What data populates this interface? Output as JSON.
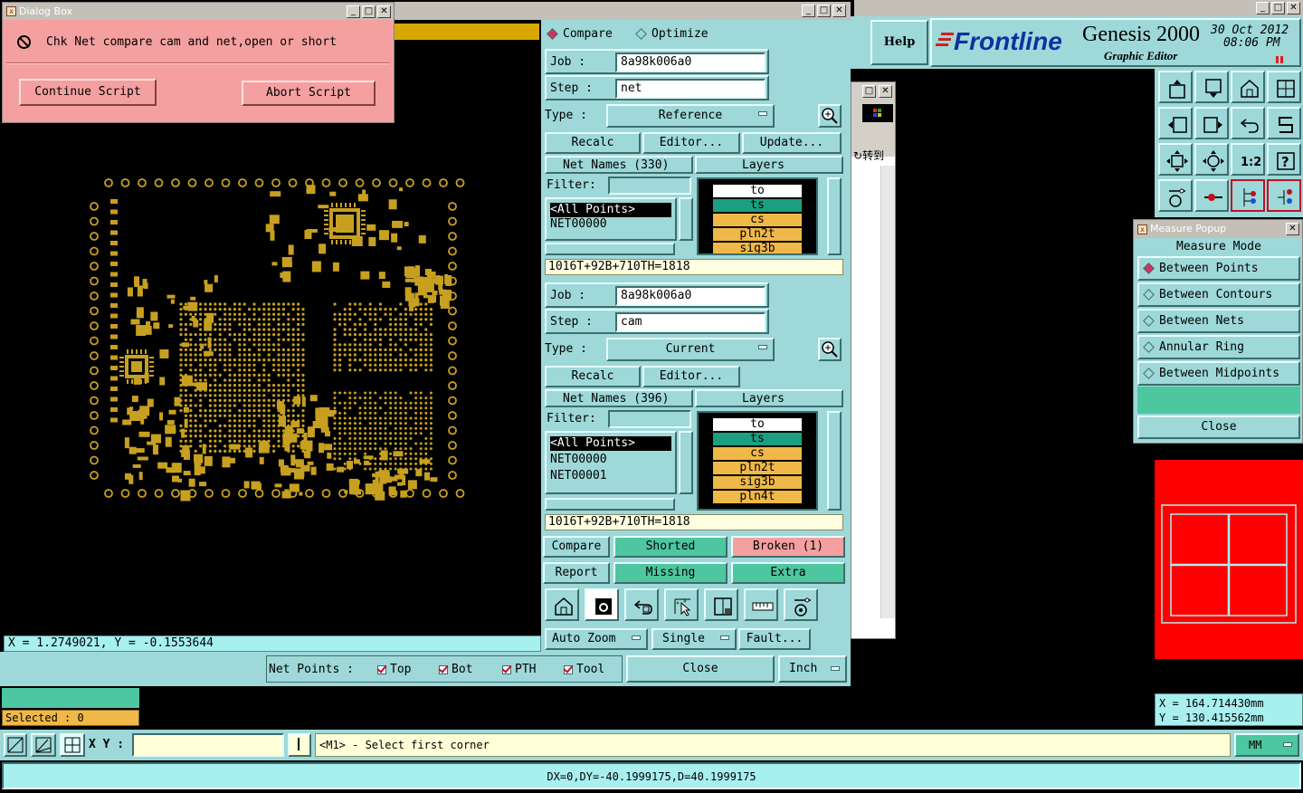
{
  "dialog": {
    "title": "Dialog Box",
    "message": "Chk Net compare cam and net,open or short",
    "continue_label": "Continue Script",
    "abort_label": "Abort Script"
  },
  "canvas": {
    "coord_readout": "X = 1.2749021, Y = -0.1553644"
  },
  "compare_panel": {
    "mode_compare": "Compare",
    "mode_optimize": "Optimize",
    "reference": {
      "job_label": "Job   :",
      "job_value": "8a98k006a0",
      "step_label": "Step  :",
      "step_value": "net",
      "type_label": "Type  :",
      "type_value": "Reference",
      "recalc": "Recalc",
      "editor": "Editor...",
      "update": "Update...",
      "net_names": "Net Names (330)",
      "layers_header": "Layers",
      "filter_label": "Filter:",
      "nets": [
        "<All Points>",
        "NET00000"
      ],
      "layers": [
        "to",
        "ts",
        "cs",
        "pln2t",
        "sig3b"
      ],
      "summary": "1016T+92B+710TH=1818"
    },
    "current": {
      "job_label": "Job   :",
      "job_value": "8a98k006a0",
      "step_label": "Step  :",
      "step_value": "cam",
      "type_label": "Type  :",
      "type_value": "Current",
      "recalc": "Recalc",
      "editor": "Editor...",
      "net_names": "Net Names (396)",
      "layers_header": "Layers",
      "filter_label": "Filter:",
      "nets": [
        "<All Points>",
        "NET00000",
        "NET00001"
      ],
      "layers": [
        "to",
        "ts",
        "cs",
        "pln2t",
        "sig3b",
        "pln4t"
      ],
      "summary": "1016T+92B+710TH=1818"
    },
    "actions": {
      "compare": "Compare",
      "shorted": "Shorted",
      "broken": "Broken (1)",
      "report": "Report",
      "missing": "Missing",
      "extra": "Extra"
    },
    "auto_zoom": "Auto Zoom",
    "single": "Single",
    "fault": "Fault...",
    "net_points_label": "Net Points :",
    "net_points": [
      "Top",
      "Bot",
      "PTH",
      "Tool"
    ],
    "close": "Close",
    "units": "Inch"
  },
  "header": {
    "help": "Help",
    "brand": "Frontline",
    "product": "Genesis 2000",
    "subtitle": "Graphic Editor",
    "date": "30 Oct 2012",
    "time": "08:06 PM"
  },
  "side_window": {
    "goto_label": "转到"
  },
  "measure_popup": {
    "title": "Measure Popup",
    "mode_header": "Measure Mode",
    "modes": [
      "Between Points",
      "Between Contours",
      "Between Nets",
      "Annular Ring",
      "Between Midpoints"
    ],
    "selected_mode": "Between Points",
    "close": "Close"
  },
  "coords_right": {
    "x": "X  =  164.714430mm",
    "y": "Y  =  130.415562mm"
  },
  "bottom": {
    "selected": "Selected : 0",
    "xy_label": "X Y :",
    "xy_value": "",
    "prompt": "<M1> - Select first corner",
    "units": "MM",
    "status": "DX=0,DY=-40.1999175,D=40.1999175"
  },
  "colors": {
    "teal": "#9ed8d8",
    "green": "#4ec6a0",
    "pink": "#f4a0a0",
    "pad_gold": "#c8a020",
    "red": "#ff0000"
  }
}
